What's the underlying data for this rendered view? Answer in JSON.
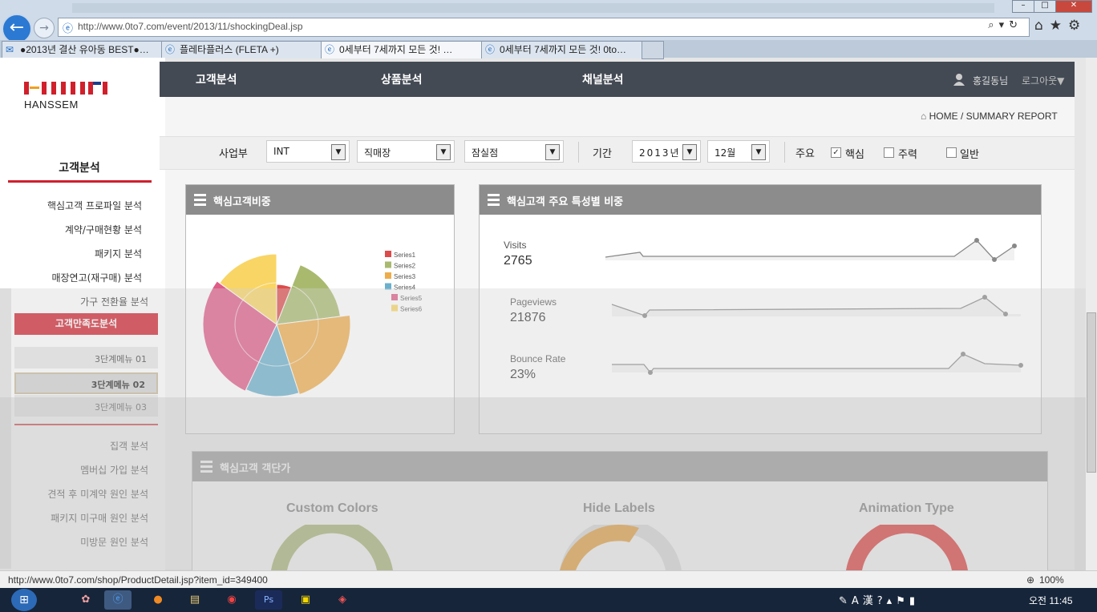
{
  "browser": {
    "url": "http://www.0to7.com/event/2013/11/shockingDeal.jsp",
    "tabs": [
      {
        "label": "●2013년 결산 유아동 BEST●…",
        "active": false
      },
      {
        "label": "플레타플러스 (FLETA +)",
        "active": false
      },
      {
        "label": "0세부터 7세까지 모든 것! …",
        "active": true
      },
      {
        "label": "0세부터 7세까지 모든 것! 0to…",
        "active": false
      }
    ],
    "status_url": "http://www.0to7.com/shop/ProductDetail.jsp?item_id=349400",
    "zoom": "100%",
    "clock": "오전 11:45"
  },
  "logo": {
    "text": "HANSSEM"
  },
  "topnav": {
    "items": [
      "고객분석",
      "상품분석",
      "채널분석"
    ],
    "user": "홍길동님",
    "logout": "로그아웃▼"
  },
  "breadcrumb": {
    "home": "HOME",
    "sep": "/",
    "current": "SUMMARY REPORT"
  },
  "filters": {
    "division_label": "사업부",
    "division": "INT",
    "channel": "직매장",
    "store": "잠실점",
    "period_label": "기간",
    "year": "2013년",
    "month": "12월",
    "main_label": "주요",
    "checks": [
      {
        "label": "핵심",
        "checked": true
      },
      {
        "label": "주력",
        "checked": false
      },
      {
        "label": "일반",
        "checked": false
      }
    ]
  },
  "sidebar": {
    "title": "고객분석",
    "items": [
      "핵심고객 프로파일 분석",
      "계약/구매현황 분석",
      "패키지 분석",
      "매장연고(재구매) 분석",
      "가구 전환율 분석"
    ],
    "active": "고객만족도분석",
    "sub_items": [
      "3단계메뉴 01",
      "3단계메뉴 02",
      "3단계메뉴 03"
    ],
    "items_after": [
      "집객 분석",
      "멤버십 가입 분석",
      "견적 후 미계약 원인 분석",
      "패키지 미구매 원인 분석",
      "미방문 원인 분석"
    ]
  },
  "panels": {
    "pie_title": "핵심고객비중",
    "stats_title": "핵심고객 주요 특성별 비중",
    "donut_title": "핵심고객 객단가"
  },
  "stats": [
    {
      "label": "Visits",
      "value": "2765"
    },
    {
      "label": "Pageviews",
      "value": "21876"
    },
    {
      "label": "Bounce Rate",
      "value": "23%"
    }
  ],
  "donuts": [
    {
      "title": "Custom Colors",
      "color": "#9aaa58"
    },
    {
      "title": "Hide Labels",
      "color": "#e88e0c"
    },
    {
      "title": "Animation Type",
      "color": "#e20808"
    }
  ],
  "chart_data": {
    "type": "pie",
    "series": [
      {
        "name": "Series1",
        "value": 6,
        "color": "#dd4b4b"
      },
      {
        "name": "Series2",
        "value": 17,
        "color": "#a9ba6f"
      },
      {
        "name": "Series3",
        "value": 22,
        "color": "#eead4b"
      },
      {
        "name": "Series4",
        "value": 12,
        "color": "#6bb0cc"
      },
      {
        "name": "Series5",
        "value": 28,
        "color": "#df5b88"
      },
      {
        "name": "Series6",
        "value": 15,
        "color": "#f9d565"
      }
    ],
    "legend": "right"
  }
}
